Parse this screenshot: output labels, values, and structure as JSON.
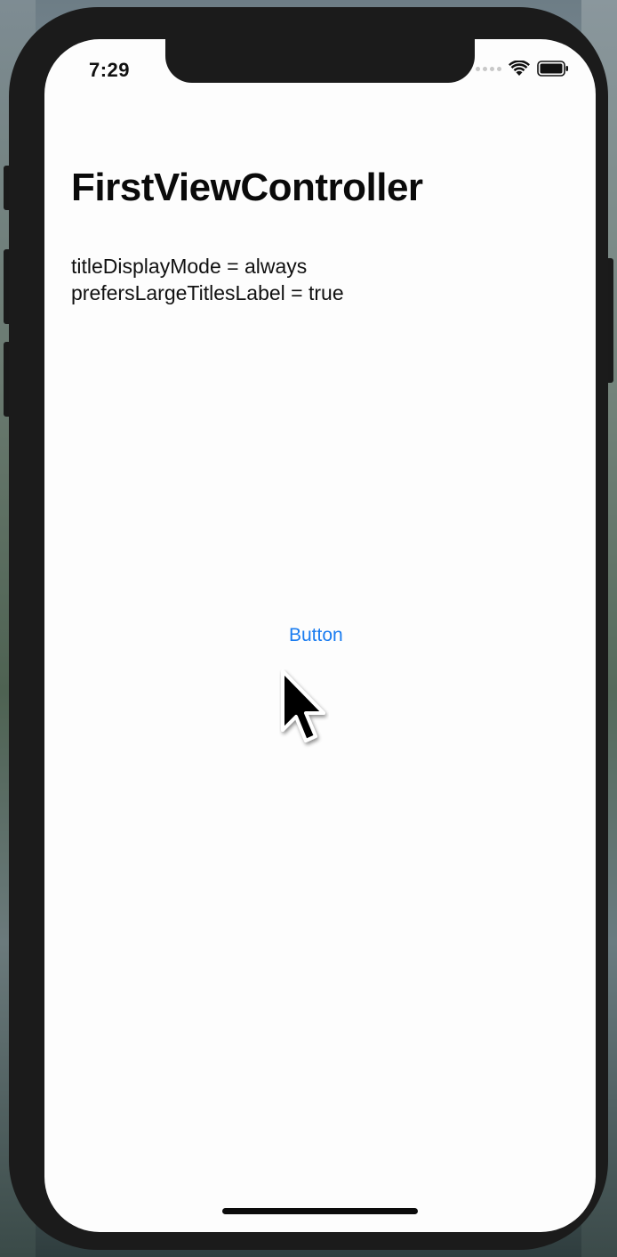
{
  "status_bar": {
    "time": "7:29",
    "icons": [
      "cellular-signal-icon",
      "wifi-icon",
      "battery-icon"
    ]
  },
  "navigation": {
    "large_title": "FirstViewController"
  },
  "content": {
    "title_display_mode_label": "titleDisplayMode = always",
    "prefers_large_titles_label": "prefersLargeTitlesLabel = true",
    "button_label": "Button"
  },
  "colors": {
    "button_tint": "#1a7cf0",
    "background": "#fdfdfd",
    "device_frame": "#1b1b1b"
  },
  "pointer": {
    "icon": "mouse-cursor-icon"
  }
}
